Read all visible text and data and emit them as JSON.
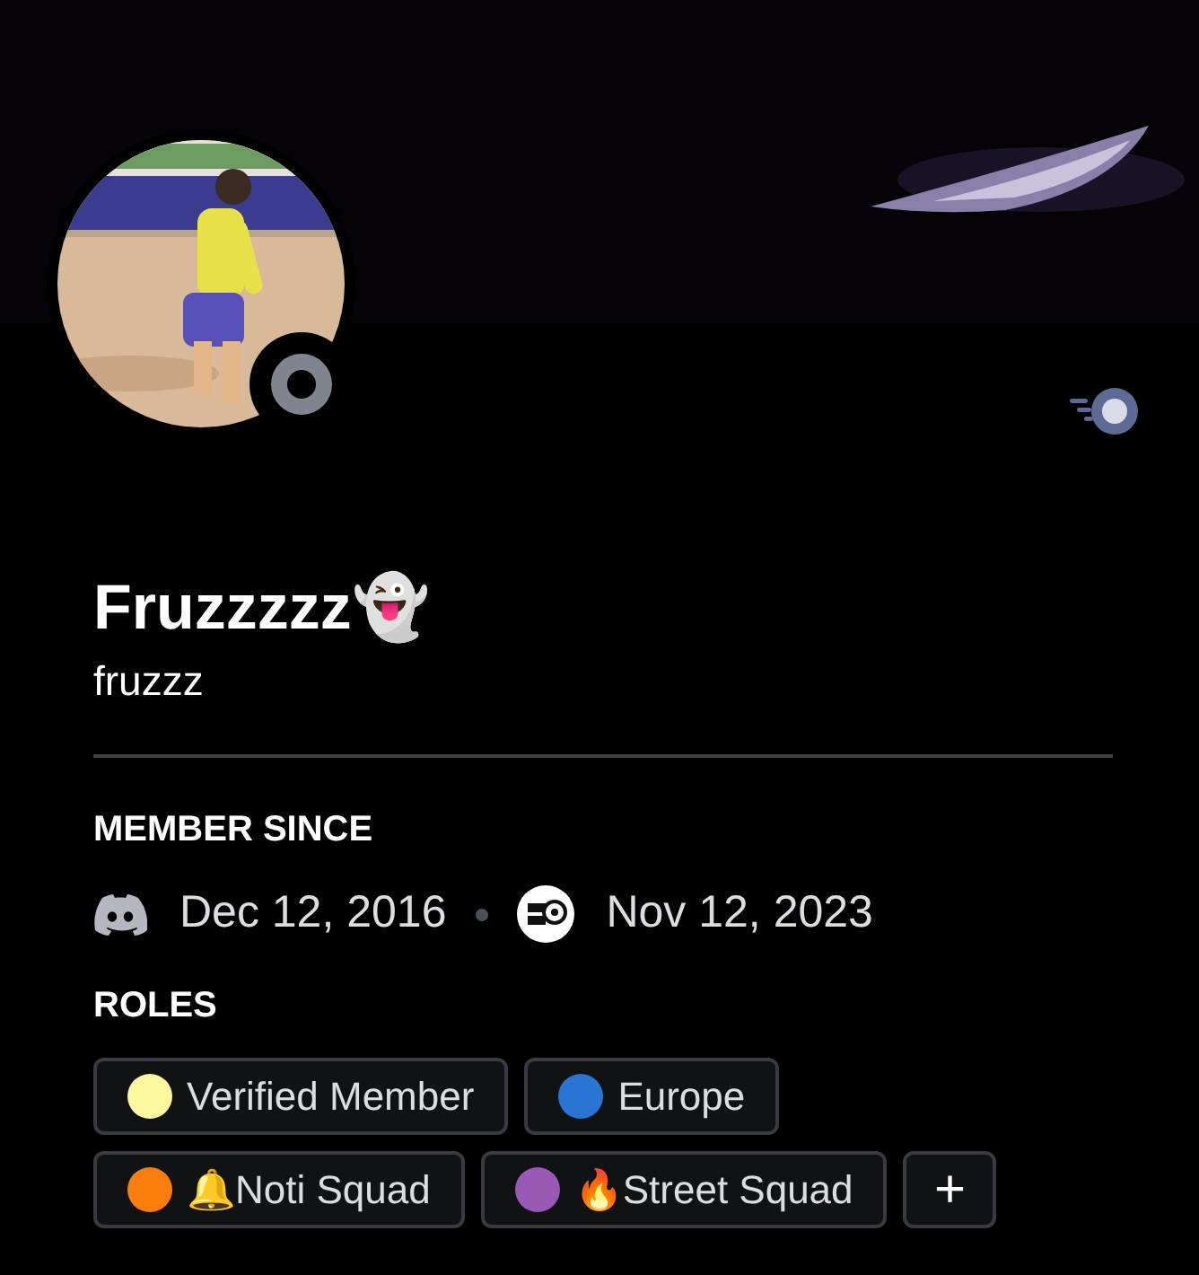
{
  "profile": {
    "display_name": "Fruzzzzz👻",
    "username": "fruzzz",
    "online": false
  },
  "member_since": {
    "heading": "MEMBER SINCE",
    "discord_date": "Dec 12, 2016",
    "server_date": "Nov 12, 2023"
  },
  "roles": {
    "heading": "ROLES",
    "items": [
      {
        "name": "Verified Member",
        "color": "#fdf8a0"
      },
      {
        "name": "Europe",
        "color": "#2a74d4"
      },
      {
        "name": "🔔Noti Squad",
        "color": "#fb7d0b"
      },
      {
        "name": "🔥Street Squad",
        "color": "#9b59b6"
      }
    ],
    "add_button": "+"
  }
}
